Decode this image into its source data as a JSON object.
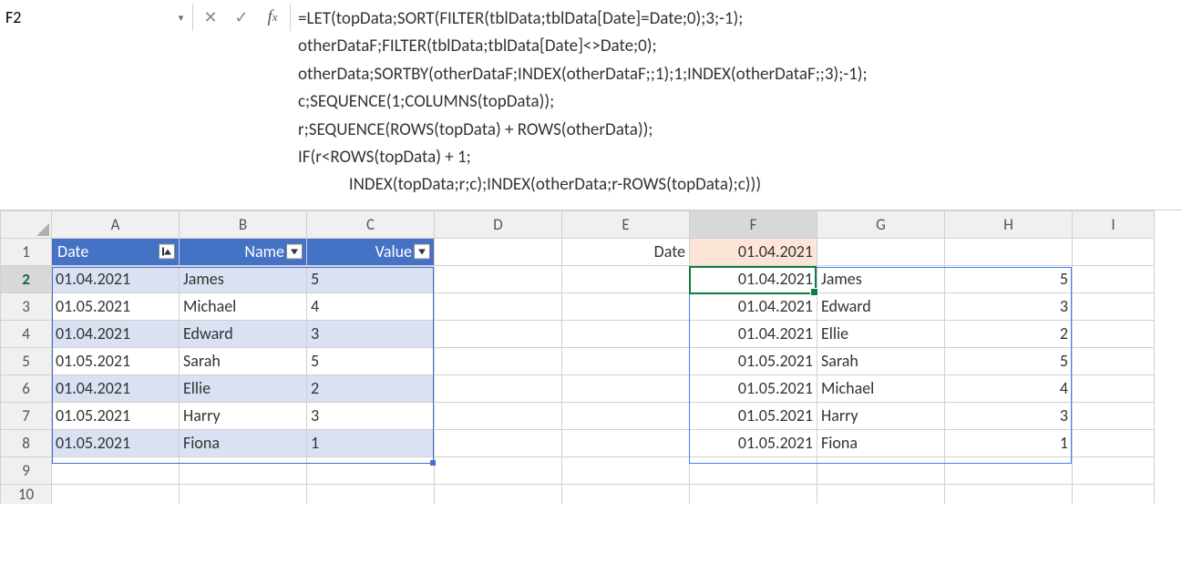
{
  "name_box": "F2",
  "formula": "=LET(topData;SORT(FILTER(tblData;tblData[Date]=Date;0);3;-1);\notherDataF;FILTER(tblData;tblData[Date]<>Date;0);\notherData;SORTBY(otherDataF;INDEX(otherDataF;;1);1;INDEX(otherDataF;;3);-1);\nc;SEQUENCE(1;COLUMNS(topData));\nr;SEQUENCE(ROWS(topData) + ROWS(otherData));\nIF(r<ROWS(topData) + 1;\n             INDEX(topData;r;c);INDEX(otherData;r-ROWS(topData);c)))",
  "columns": [
    "A",
    "B",
    "C",
    "D",
    "E",
    "F",
    "G",
    "H",
    "I"
  ],
  "row_headers": [
    "1",
    "2",
    "3",
    "4",
    "5",
    "6",
    "7",
    "8",
    "9",
    "10"
  ],
  "active_col": "F",
  "active_row": "2",
  "table": {
    "headers": {
      "date": "Date",
      "name": "Name",
      "value": "Value"
    },
    "rows": [
      {
        "date": "01.04.2021",
        "name": "James",
        "value": "5"
      },
      {
        "date": "01.05.2021",
        "name": "Michael",
        "value": "4"
      },
      {
        "date": "01.04.2021",
        "name": "Edward",
        "value": "3"
      },
      {
        "date": "01.05.2021",
        "name": "Sarah",
        "value": "5"
      },
      {
        "date": "01.04.2021",
        "name": "Ellie",
        "value": "2"
      },
      {
        "date": "01.05.2021",
        "name": "Harry",
        "value": "3"
      },
      {
        "date": "01.05.2021",
        "name": "Fiona",
        "value": "1"
      }
    ]
  },
  "lookup": {
    "label": "Date",
    "value": "01.04.2021"
  },
  "result": [
    {
      "c1": "01.04.2021",
      "c2": "James",
      "c3": "5"
    },
    {
      "c1": "01.04.2021",
      "c2": "Edward",
      "c3": "3"
    },
    {
      "c1": "01.04.2021",
      "c2": "Ellie",
      "c3": "2"
    },
    {
      "c1": "01.05.2021",
      "c2": "Sarah",
      "c3": "5"
    },
    {
      "c1": "01.05.2021",
      "c2": "Michael",
      "c3": "4"
    },
    {
      "c1": "01.05.2021",
      "c2": "Harry",
      "c3": "3"
    },
    {
      "c1": "01.05.2021",
      "c2": "Fiona",
      "c3": "1"
    }
  ]
}
